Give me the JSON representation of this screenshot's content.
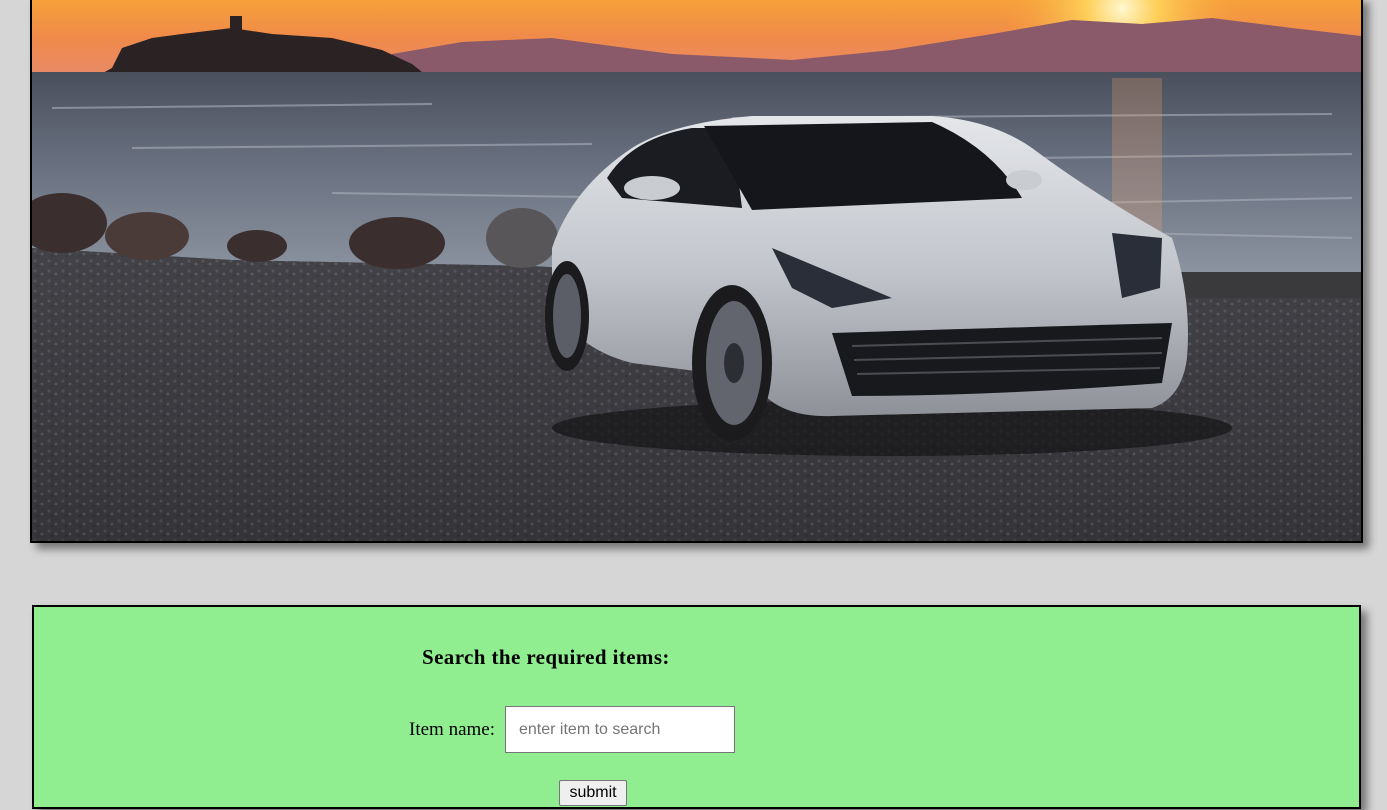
{
  "hero": {
    "image_description_icon": "car-photo"
  },
  "search": {
    "heading": "Search the required items:",
    "field_label": "Item name:",
    "placeholder": "enter item to search",
    "value": "",
    "submit_label": "submit"
  },
  "colors": {
    "page_background": "#d6d6d6",
    "panel_background": "#90ee90"
  }
}
